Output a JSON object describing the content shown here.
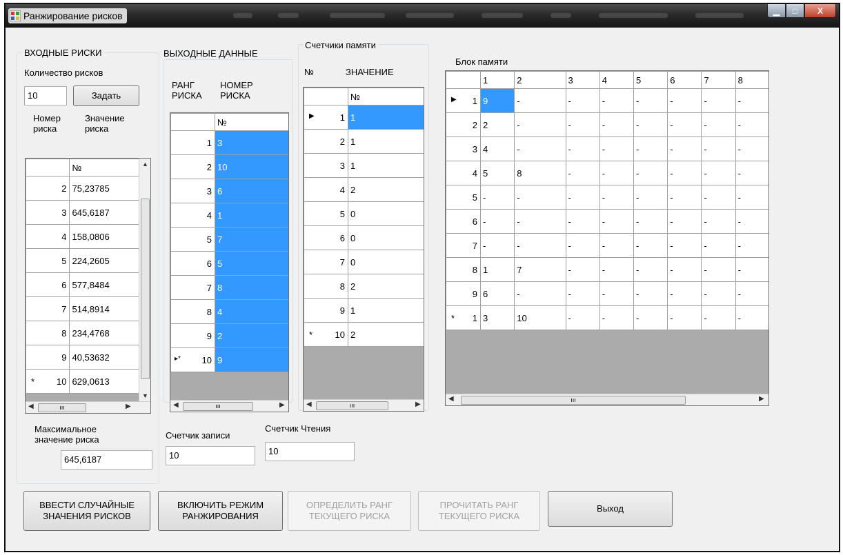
{
  "window": {
    "title": "Ранжирование рисков"
  },
  "input_group": {
    "title": "ВХОДНЫЕ РИСКИ",
    "count_label": "Количество рисков",
    "count_value": "10",
    "set_button": "Задать",
    "col1_header": "Номер\nриска",
    "col2_header": "Значение\nриска",
    "grid_header": "№",
    "rows": [
      {
        "n": "2",
        "v": "75,23785"
      },
      {
        "n": "3",
        "v": "645,6187"
      },
      {
        "n": "4",
        "v": "158,0806"
      },
      {
        "n": "5",
        "v": "224,2605"
      },
      {
        "n": "6",
        "v": "577,8484"
      },
      {
        "n": "7",
        "v": "514,8914"
      },
      {
        "n": "8",
        "v": "234,4768"
      },
      {
        "n": "9",
        "v": "40,53632"
      },
      {
        "n": "10",
        "v": "629,0613"
      }
    ],
    "new_row_marker": "*",
    "max_label": "Максимальное\nзначение риска",
    "max_value": "645,6187"
  },
  "output_group": {
    "title": "ВЫХОДНЫЕ ДАННЫЕ",
    "col1_header": "РАНГ\nРИСКА",
    "col2_header": "НОМЕР\nРИСКА",
    "grid_header": "№",
    "rows": [
      {
        "n": "1",
        "v": "3"
      },
      {
        "n": "2",
        "v": "10"
      },
      {
        "n": "3",
        "v": "6"
      },
      {
        "n": "4",
        "v": "1"
      },
      {
        "n": "5",
        "v": "7"
      },
      {
        "n": "6",
        "v": "5"
      },
      {
        "n": "7",
        "v": "8"
      },
      {
        "n": "8",
        "v": "4"
      },
      {
        "n": "9",
        "v": "2"
      },
      {
        "n": "10",
        "v": "9"
      }
    ],
    "last_row_marker": "▸*",
    "write_counter_label": "Счетчик записи",
    "write_counter_value": "10"
  },
  "memory_counters": {
    "title": "Счетчики памяти",
    "col1_header": "№",
    "col2_header": "ЗНАЧЕНИЕ",
    "grid_header": "№",
    "rows": [
      {
        "n": "1",
        "v": "1"
      },
      {
        "n": "2",
        "v": "1"
      },
      {
        "n": "3",
        "v": "1"
      },
      {
        "n": "4",
        "v": "2"
      },
      {
        "n": "5",
        "v": "0"
      },
      {
        "n": "6",
        "v": "0"
      },
      {
        "n": "7",
        "v": "0"
      },
      {
        "n": "8",
        "v": "2"
      },
      {
        "n": "9",
        "v": "1"
      },
      {
        "n": "10",
        "v": "2"
      }
    ],
    "current_row_marker": "▶",
    "new_row_marker": "*",
    "read_counter_label": "Счетчик Чтения",
    "read_counter_value": "10"
  },
  "memory_block": {
    "title": "Блок памяти",
    "columns": [
      "1",
      "2",
      "3",
      "4",
      "5",
      "6",
      "7",
      "8"
    ],
    "rows": [
      {
        "n": "1",
        "cells": [
          "9",
          "-",
          "-",
          "-",
          "-",
          "-",
          "-",
          "-"
        ]
      },
      {
        "n": "2",
        "cells": [
          "2",
          "-",
          "-",
          "-",
          "-",
          "-",
          "-",
          "-"
        ]
      },
      {
        "n": "3",
        "cells": [
          "4",
          "-",
          "-",
          "-",
          "-",
          "-",
          "-",
          "-"
        ]
      },
      {
        "n": "4",
        "cells": [
          "5",
          "8",
          "-",
          "-",
          "-",
          "-",
          "-",
          "-"
        ]
      },
      {
        "n": "5",
        "cells": [
          "-",
          "-",
          "-",
          "-",
          "-",
          "-",
          "-",
          "-"
        ]
      },
      {
        "n": "6",
        "cells": [
          "-",
          "-",
          "-",
          "-",
          "-",
          "-",
          "-",
          "-"
        ]
      },
      {
        "n": "7",
        "cells": [
          "-",
          "-",
          "-",
          "-",
          "-",
          "-",
          "-",
          "-"
        ]
      },
      {
        "n": "8",
        "cells": [
          "1",
          "7",
          "-",
          "-",
          "-",
          "-",
          "-",
          "-"
        ]
      },
      {
        "n": "9",
        "cells": [
          "6",
          "-",
          "-",
          "-",
          "-",
          "-",
          "-",
          "-"
        ]
      },
      {
        "n": "1",
        "cells": [
          "3",
          "10",
          "-",
          "-",
          "-",
          "-",
          "-",
          "-"
        ]
      }
    ],
    "current_row_marker": "▶",
    "new_row_marker": "*"
  },
  "buttons": {
    "random": "ВВЕСТИ СЛУЧАЙНЫЕ\nЗНАЧЕНИЯ РИСКОВ",
    "ranking": "ВКЛЮЧИТЬ РЕЖИМ\nРАНЖИРОВАНИЯ",
    "define_rank": "ОПРЕДЕЛИТЬ РАНГ\nТЕКУЩЕГО РИСКА",
    "read_rank": "ПРОЧИТАТЬ РАНГ\nТЕКУЩЕГО РИСКА",
    "exit": "Выход"
  },
  "colors": {
    "selection": "#3399ff",
    "grid_bg": "#ababab",
    "form_bg": "#f0f0f0"
  },
  "icons": {
    "app": "app-icon",
    "minimize": "minimize-icon",
    "maximize": "maximize-icon",
    "close": "close-icon"
  }
}
